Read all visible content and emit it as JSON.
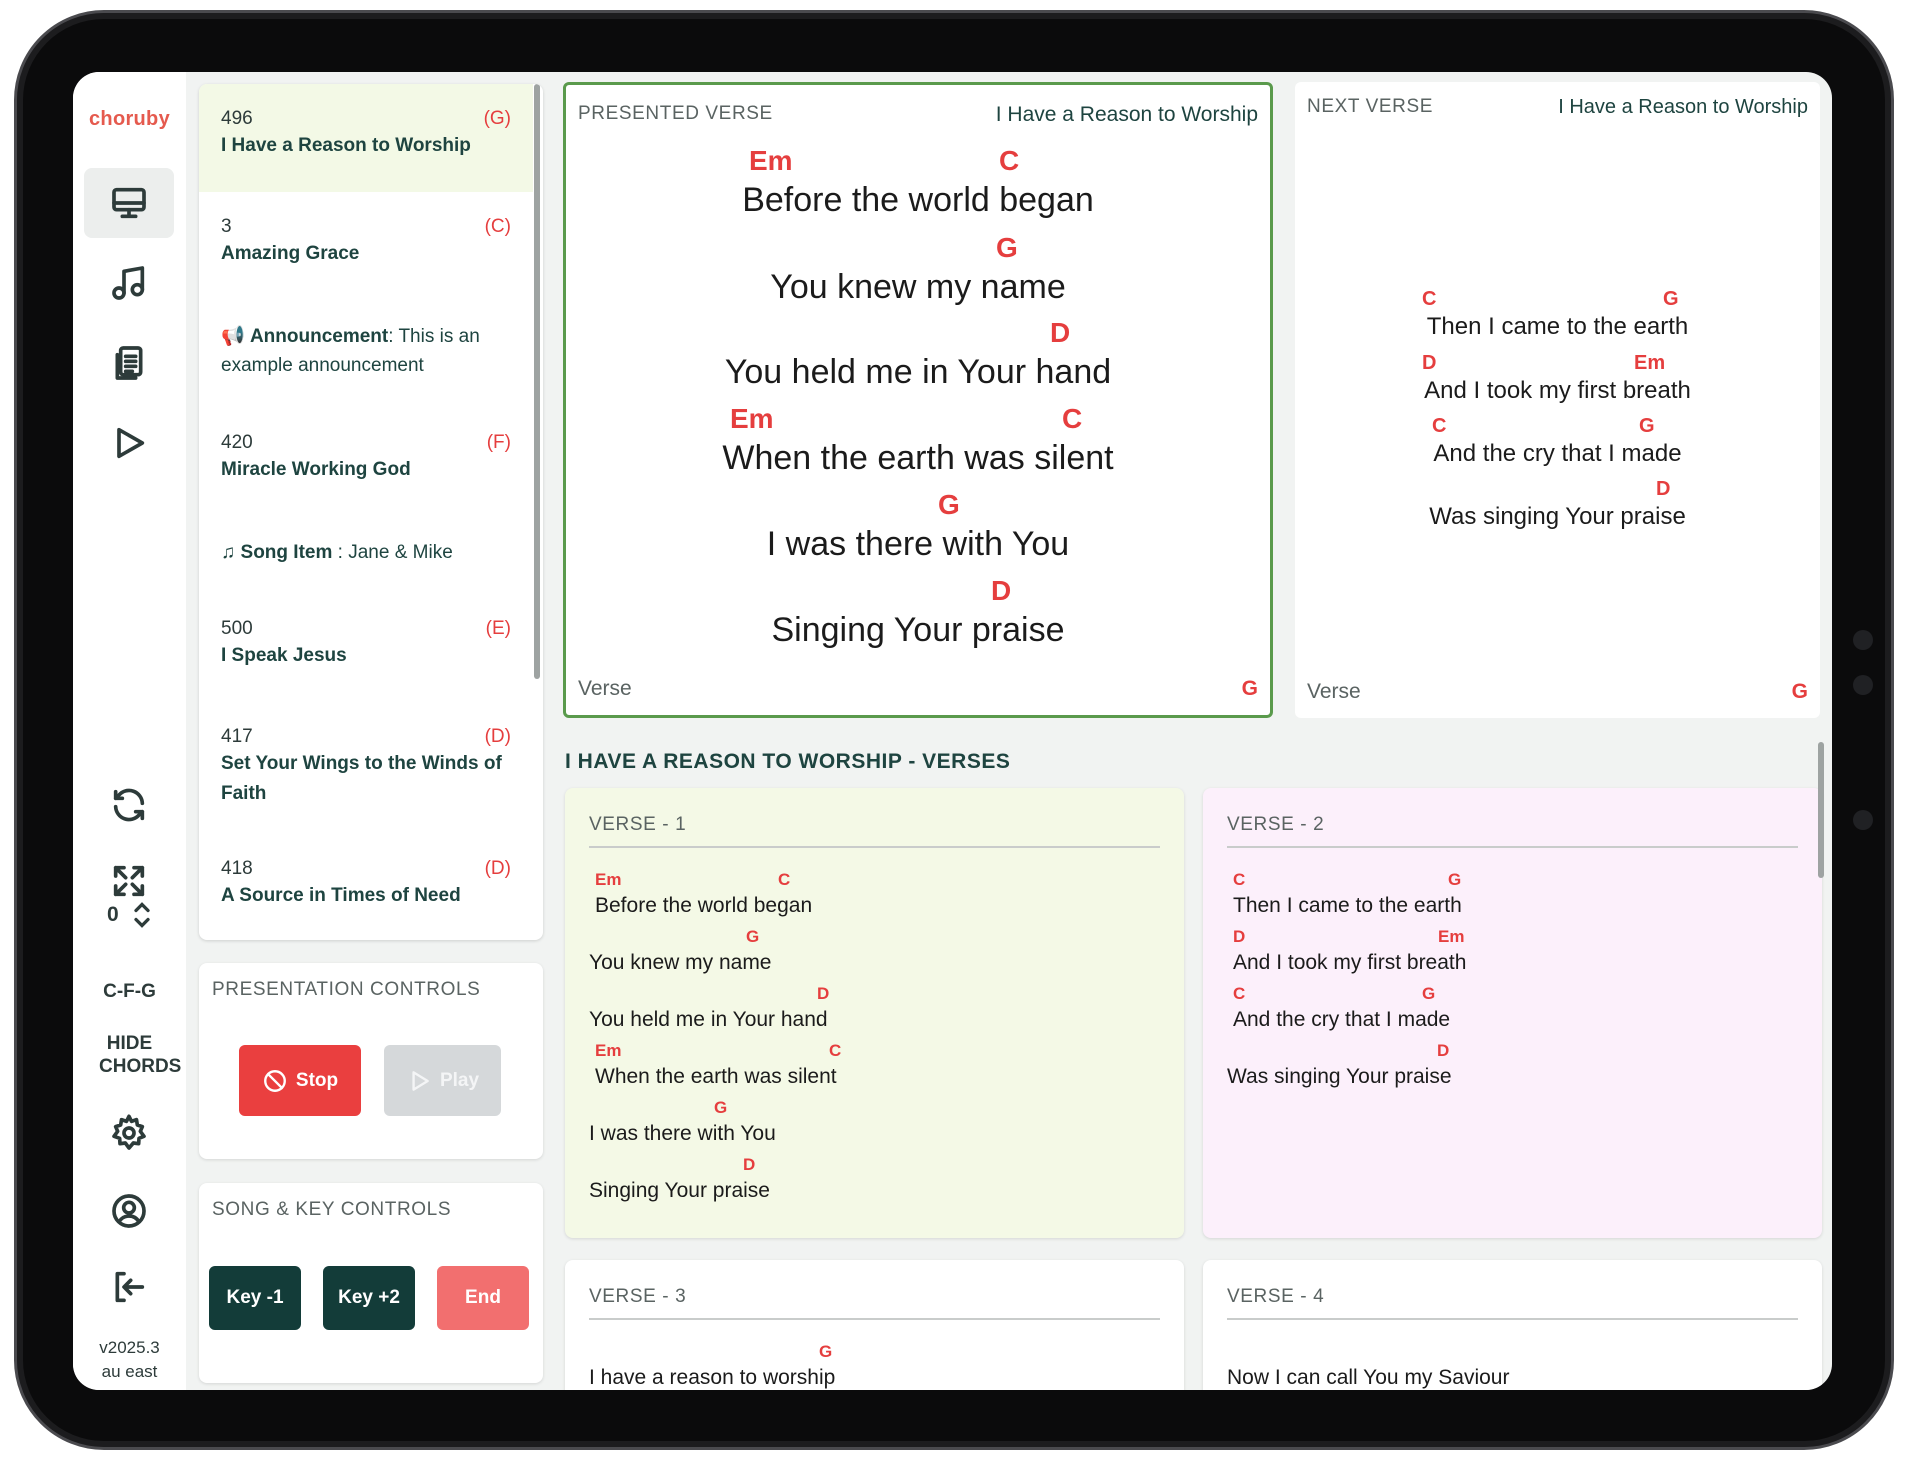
{
  "app": {
    "logo": "choruby",
    "version": "v2025.3",
    "region": "au east"
  },
  "rail": {
    "items": [
      {
        "name": "present",
        "icon": "monitor-icon",
        "active": true
      },
      {
        "name": "songs",
        "icon": "music-note-icon"
      },
      {
        "name": "setlists",
        "icon": "clipboard-list-icon"
      },
      {
        "name": "play",
        "icon": "play-icon"
      }
    ],
    "zoom_value": "0",
    "key_sequence": "C-F-G",
    "hide_chords": "HIDE CHORDS"
  },
  "setlist": [
    {
      "number": "496",
      "key": "(G)",
      "title": "I Have a Reason to Worship",
      "active": true
    },
    {
      "number": "3",
      "key": "(C)",
      "title": "Amazing Grace"
    },
    {
      "type": "announcement",
      "label": "Announcement",
      "text": ": This is an example announcement"
    },
    {
      "number": "420",
      "key": "(F)",
      "title": "Miracle Working God"
    },
    {
      "type": "song-item",
      "label": "Song Item",
      "text": " : Jane & Mike"
    },
    {
      "number": "500",
      "key": "(E)",
      "title": "I Speak Jesus"
    },
    {
      "number": "417",
      "key": "(D)",
      "title": "Set Your Wings to the Winds of Faith"
    },
    {
      "number": "418",
      "key": "(D)",
      "title": "A Source in Times of Need"
    }
  ],
  "presentation_controls": {
    "title": "PRESENTATION CONTROLS",
    "stop": "Stop",
    "play": "Play"
  },
  "song_key_controls": {
    "title": "SONG & KEY CONTROLS",
    "key_down": "Key -1",
    "key_up": "Key +2",
    "end": "End"
  },
  "presented": {
    "label": "PRESENTED VERSE",
    "song": "I Have a Reason to Worship",
    "footer": "Verse",
    "key": "G",
    "chords": [
      "Em",
      "C",
      "G",
      "D",
      "Em",
      "C",
      "G",
      "D"
    ],
    "lines": [
      "Before the world began",
      "You knew my name",
      "You held me in Your hand",
      "When the earth was silent",
      "I was there with You",
      "Singing Your praise"
    ]
  },
  "next": {
    "label": "NEXT VERSE",
    "song": "I Have a Reason to Worship",
    "footer": "Verse",
    "key": "G",
    "chords": [
      "C",
      "G",
      "D",
      "Em",
      "C",
      "G",
      "D"
    ],
    "lines": [
      "Then I came to the earth",
      "And I took my first breath",
      "And the cry that I made",
      "Was singing Your praise"
    ]
  },
  "verses_section": {
    "title": "I HAVE A REASON TO WORSHIP - VERSES",
    "verses": [
      {
        "head": "VERSE - 1",
        "chords": [
          "Em",
          "C",
          "G",
          "D",
          "Em",
          "C",
          "G",
          "D"
        ],
        "lines": [
          "Before the world began",
          "You knew my name",
          "You held me in Your hand",
          "When the earth was silent",
          "I was there with You",
          "Singing Your praise"
        ]
      },
      {
        "head": "VERSE - 2",
        "chords": [
          "C",
          "G",
          "D",
          "Em",
          "C",
          "G",
          "D"
        ],
        "lines": [
          "Then I came to the earth",
          "And I took my first breath",
          "And the cry that I made",
          "Was singing Your praise"
        ]
      },
      {
        "head": "VERSE - 3",
        "chords": [
          "G"
        ],
        "lines": [
          "I have a reason to worship"
        ]
      },
      {
        "head": "VERSE - 4",
        "lines": [
          "Now I can call You my Saviour"
        ]
      }
    ]
  }
}
